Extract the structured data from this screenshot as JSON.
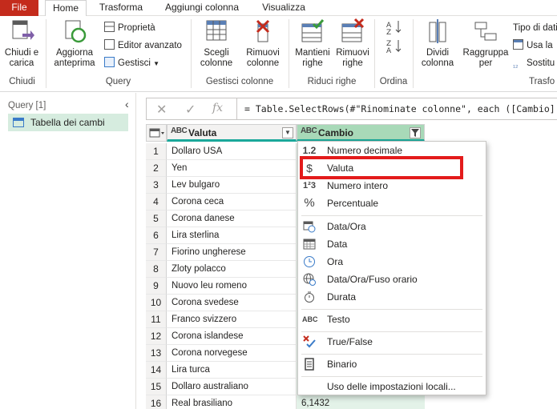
{
  "tabs": [
    {
      "label": "File"
    },
    {
      "label": "Home"
    },
    {
      "label": "Trasforma"
    },
    {
      "label": "Aggiungi colonna"
    },
    {
      "label": "Visualizza"
    }
  ],
  "ribbon": {
    "chiudi": {
      "button": "Chiudi e\ncarica",
      "group": "Chiudi"
    },
    "query": {
      "aggiorna": "Aggiorna\nanteprima",
      "proprieta": "Proprietà",
      "editor": "Editor avanzato",
      "gestisci": "Gestisci",
      "group": "Query"
    },
    "gestisci_colonne": {
      "scegli": "Scegli\ncolonne",
      "rimuovi": "Rimuovi\ncolonne",
      "group": "Gestisci colonne"
    },
    "riduci_righe": {
      "mantieni": "Mantieni\nrighe",
      "rimuovi": "Rimuovi\nrighe",
      "group": "Riduci righe"
    },
    "ordina": {
      "group": "Ordina"
    },
    "trasforma": {
      "dividi": "Dividi\ncolonna",
      "raggruppa": "Raggruppa\nper",
      "tipo_dati": "Tipo di dati",
      "usa_la": "Usa la",
      "sostituisci": "Sostitu",
      "group": "Trasfo"
    }
  },
  "query_panel": {
    "header": "Query [1]",
    "items": [
      {
        "label": "Tabella dei cambi"
      }
    ]
  },
  "formula_bar": {
    "formula": "= Table.SelectRows(#\"Rinominate colonne\", each ([Cambio] <> "
  },
  "grid": {
    "columns": [
      {
        "name": "Valuta",
        "type": "ABC"
      },
      {
        "name": "Cambio",
        "type": "ABC"
      }
    ],
    "rows": [
      {
        "idx": "1",
        "valuta": "Dollaro USA",
        "cambio": ""
      },
      {
        "idx": "2",
        "valuta": "Yen",
        "cambio": ""
      },
      {
        "idx": "3",
        "valuta": "Lev bulgaro",
        "cambio": ""
      },
      {
        "idx": "4",
        "valuta": "Corona ceca",
        "cambio": ""
      },
      {
        "idx": "5",
        "valuta": "Corona danese",
        "cambio": ""
      },
      {
        "idx": "6",
        "valuta": "Lira sterlina",
        "cambio": ""
      },
      {
        "idx": "7",
        "valuta": "Fiorino ungherese",
        "cambio": ""
      },
      {
        "idx": "8",
        "valuta": "Zloty polacco",
        "cambio": ""
      },
      {
        "idx": "9",
        "valuta": "Nuovo leu romeno",
        "cambio": ""
      },
      {
        "idx": "10",
        "valuta": "Corona svedese",
        "cambio": ""
      },
      {
        "idx": "11",
        "valuta": "Franco svizzero",
        "cambio": ""
      },
      {
        "idx": "12",
        "valuta": "Corona islandese",
        "cambio": ""
      },
      {
        "idx": "13",
        "valuta": "Corona norvegese",
        "cambio": ""
      },
      {
        "idx": "14",
        "valuta": "Lira turca",
        "cambio": ""
      },
      {
        "idx": "15",
        "valuta": "Dollaro australiano",
        "cambio": ""
      },
      {
        "idx": "16",
        "valuta": "Real brasiliano",
        "cambio": "6,1432"
      }
    ]
  },
  "type_menu": {
    "items": [
      {
        "label": "Numero decimale",
        "icon": "1.2"
      },
      {
        "label": "Valuta",
        "icon": "$"
      },
      {
        "label": "Numero intero",
        "icon": "1²3"
      },
      {
        "label": "Percentuale",
        "icon": "%"
      },
      {
        "label": "Data/Ora",
        "icon": "datetime-icon"
      },
      {
        "label": "Data",
        "icon": "calendar-icon"
      },
      {
        "label": "Ora",
        "icon": "clock-icon"
      },
      {
        "label": "Data/Ora/Fuso orario",
        "icon": "globe-icon"
      },
      {
        "label": "Durata",
        "icon": "stopwatch-icon"
      },
      {
        "label": "Testo",
        "icon": "ABC"
      },
      {
        "label": "True/False",
        "icon": "true-false-icon"
      },
      {
        "label": "Binario",
        "icon": "binary-icon"
      },
      {
        "label": "Uso delle impostazioni locali...",
        "icon": ""
      }
    ]
  },
  "colors": {
    "file_tab": "#c42b1c",
    "selected_column": "#a8d9b8",
    "highlight": "#e31b1b",
    "accent": "#1aa89a"
  }
}
